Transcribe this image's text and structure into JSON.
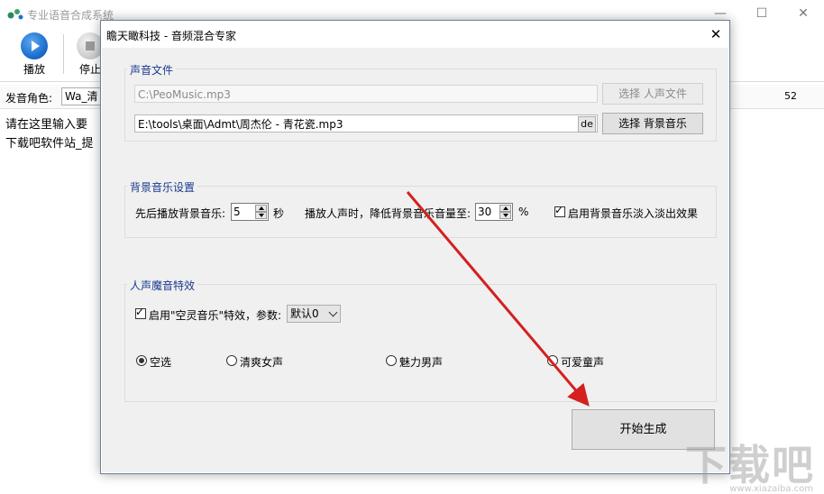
{
  "main": {
    "title": "专业语音合成系统",
    "toolbar": {
      "play_label": "播放",
      "stop_label": "停止"
    },
    "voice_label": "发音角色:",
    "voice_value": "Wa_清",
    "counter": "52",
    "text_line1": "请在这里输入要",
    "text_line2": "下载吧软件站_提"
  },
  "dialog": {
    "title": "瞻天瞰科技 - 音频混合专家",
    "sound_group": {
      "title": "声音文件",
      "vocal_path": "C:\\PeoMusic.mp3",
      "select_vocal_label": "选择 人声文件",
      "bgm_path": "E:\\tools\\桌面\\Admt\\周杰伦 - 青花瓷.mp3",
      "de_label": "de",
      "select_bgm_label": "选择 背景音乐"
    },
    "bgm_group": {
      "title": "背景音乐设置",
      "lead_label": "先后播放背景音乐:",
      "lead_value": "5",
      "seconds_unit": "秒",
      "lower_label": "播放人声时，降低背景音乐音量至:",
      "lower_value": "30",
      "percent_unit": "%",
      "fade_label": "启用背景音乐淡入淡出效果",
      "fade_checked": true
    },
    "effect_group": {
      "title": "人声魔音特效",
      "enable_label": "启用\"空灵音乐\"特效，参数:",
      "enable_checked": true,
      "param_value": "默认0",
      "radios": [
        {
          "label": "空选",
          "checked": true
        },
        {
          "label": "清爽女声",
          "checked": false
        },
        {
          "label": "魅力男声",
          "checked": false
        },
        {
          "label": "可爱童声",
          "checked": false
        }
      ]
    },
    "start_label": "开始生成"
  },
  "watermark": {
    "big": "下载吧",
    "small": "www.xiazaiba.com"
  },
  "colors": {
    "arrow": "#d42020",
    "group_title": "#1a3a8f",
    "play_icon": "#1e6fd0"
  },
  "icons": {
    "close": "close-icon",
    "minimize": "minimize-icon",
    "maximize": "maximize-icon"
  }
}
